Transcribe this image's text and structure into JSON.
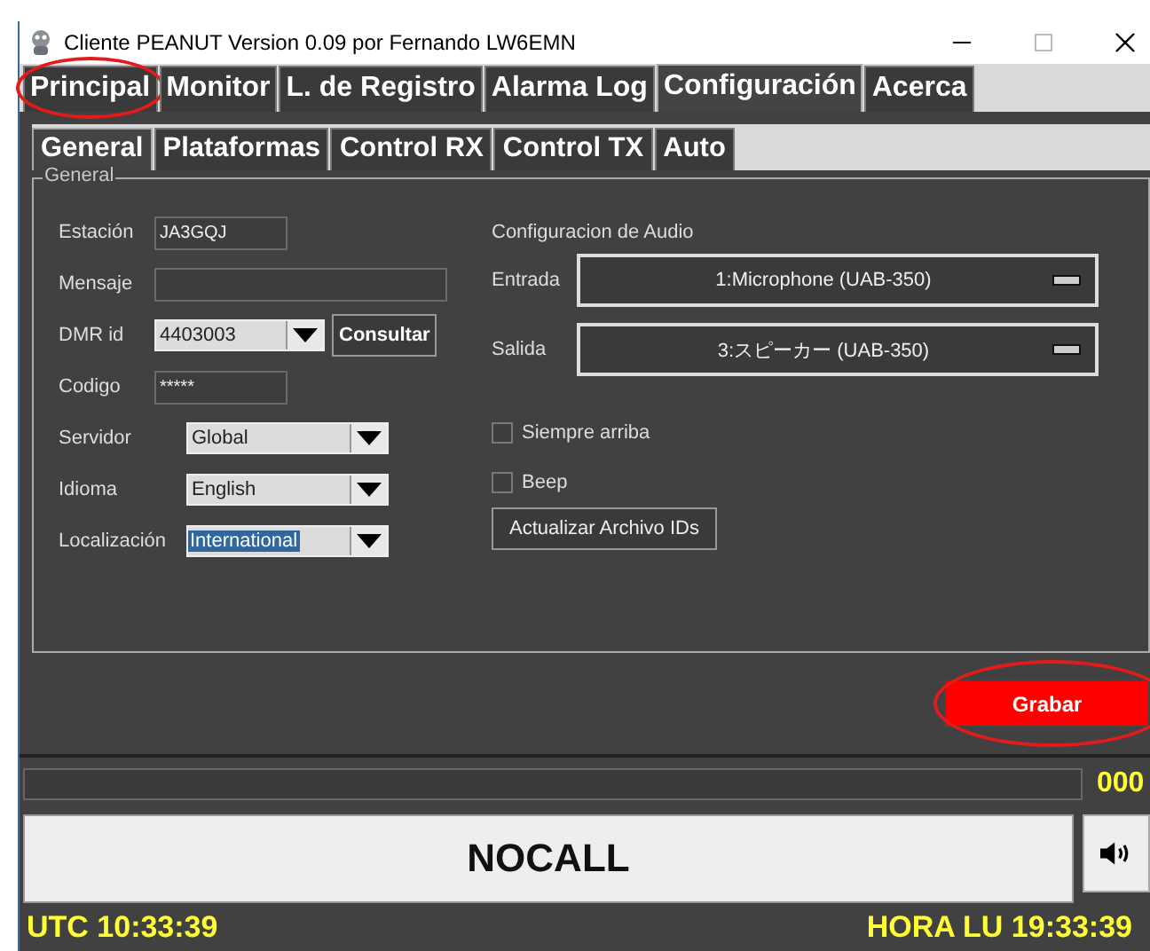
{
  "window": {
    "title": "Cliente PEANUT  Version 0.09 por Fernando LW6EMN"
  },
  "tabs": [
    {
      "label": "Principal",
      "selected": false,
      "circled": true
    },
    {
      "label": "Monitor",
      "selected": false,
      "circled": false
    },
    {
      "label": "L. de Registro",
      "selected": false,
      "circled": false
    },
    {
      "label": "Alarma Log",
      "selected": false,
      "circled": false
    },
    {
      "label": "Configuración",
      "selected": true,
      "circled": false
    },
    {
      "label": "Acerca",
      "selected": false,
      "circled": false
    }
  ],
  "subtabs": [
    {
      "label": "General",
      "selected": true
    },
    {
      "label": "Plataformas",
      "selected": false
    },
    {
      "label": "Control RX",
      "selected": false
    },
    {
      "label": "Control TX",
      "selected": false
    },
    {
      "label": "Auto",
      "selected": false
    }
  ],
  "group": {
    "title": "General",
    "fields": [
      {
        "label": "Estación",
        "kind": "text",
        "value": "JA3GQJ"
      },
      {
        "label": "Mensaje",
        "kind": "text"
      },
      {
        "label": "DMR id",
        "kind": "combo",
        "value": "4403003",
        "button": "Consultar"
      },
      {
        "label": "Codigo",
        "kind": "text",
        "value": "*****"
      },
      {
        "label": "Servidor",
        "kind": "combo",
        "value": "Global"
      },
      {
        "label": "Idioma",
        "kind": "combo",
        "value": "English"
      },
      {
        "label": "Localización",
        "kind": "combo",
        "value": "International",
        "text_selected": true
      }
    ],
    "audio": {
      "title": "Configuracion de Audio",
      "devices": [
        {
          "label": "Entrada",
          "value": "1:Microphone (UAB-350)"
        },
        {
          "label": "Salida",
          "value": "3:スピーカー (UAB-350)"
        }
      ]
    },
    "checkboxes": [
      {
        "label": "Siempre arriba",
        "checked": false
      },
      {
        "label": "Beep",
        "checked": false
      }
    ],
    "update_button": "Actualizar Archivo IDs"
  },
  "save_button": {
    "label": "Grabar",
    "circled": true
  },
  "progress": {
    "level": 0,
    "counter": "000"
  },
  "callsign": "NOCALL",
  "status_bar": {
    "utc": "UTC 10:33:39",
    "local": "HORA LU 19:33:39"
  }
}
